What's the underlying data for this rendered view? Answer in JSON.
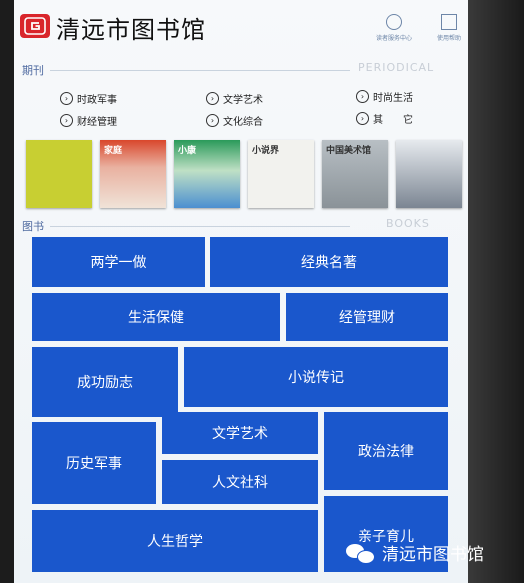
{
  "header": {
    "title": "清远市图书馆",
    "btn_left_label": "读者服务中心",
    "btn_right_label": "使用帮助"
  },
  "periodical": {
    "title": "期刊",
    "english": "PERIODICAL",
    "categories": [
      {
        "label": "时政军事"
      },
      {
        "label": "文学艺术"
      },
      {
        "label": "时尚生活"
      },
      {
        "label": "财经管理"
      },
      {
        "label": "文化综合"
      },
      {
        "label": "其　　它"
      }
    ],
    "covers": [
      {
        "title": "",
        "color": "#c8cf32"
      },
      {
        "title": "家庭",
        "color": "#d9472c"
      },
      {
        "title": "小康",
        "color": "#2a9a5a"
      },
      {
        "title": "小说界",
        "color": "#f2f2ee"
      },
      {
        "title": "中国美术馆",
        "color": "#9aa1a6"
      },
      {
        "title": "",
        "color": "#d8dde2"
      }
    ]
  },
  "books": {
    "title": "图书",
    "english": "BOOKS",
    "tiles": [
      "两学一做",
      "经典名著",
      "生活保健",
      "经管理财",
      "成功励志",
      "小说传记",
      "文学艺术",
      "政治法律",
      "历史军事",
      "人文社科",
      "人生哲学",
      "亲子育儿"
    ]
  },
  "watermark": {
    "text": "清远市图书馆"
  },
  "colors": {
    "tile": "#1a57cc",
    "section": "#4f6aa0",
    "logo": "#d9252b"
  }
}
